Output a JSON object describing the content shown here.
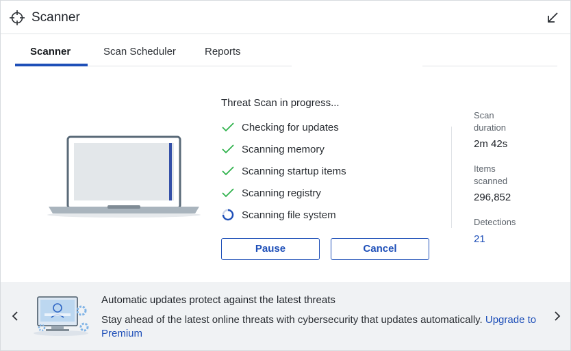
{
  "window": {
    "title": "Scanner",
    "title_icon": "crosshair-icon",
    "collapse_icon": "arrow-down-left-icon"
  },
  "tabs": [
    {
      "label": "Scanner",
      "active": true
    },
    {
      "label": "Scan Scheduler",
      "active": false
    },
    {
      "label": "Reports",
      "active": false
    }
  ],
  "scan": {
    "title": "Threat Scan in progress...",
    "steps": [
      {
        "label": "Checking for updates",
        "status": "done",
        "icon": "check-icon"
      },
      {
        "label": "Scanning memory",
        "status": "done",
        "icon": "check-icon"
      },
      {
        "label": "Scanning startup items",
        "status": "done",
        "icon": "check-icon"
      },
      {
        "label": "Scanning registry",
        "status": "done",
        "icon": "check-icon"
      },
      {
        "label": "Scanning file system",
        "status": "in-progress",
        "icon": "spinner-icon"
      }
    ],
    "pause_label": "Pause",
    "cancel_label": "Cancel"
  },
  "stats": {
    "duration_label": "Scan duration",
    "duration_value": "2m 42s",
    "items_label": "Items scanned",
    "items_value": "296,852",
    "detections_label": "Detections",
    "detections_value": "21"
  },
  "banner": {
    "title": "Automatic updates protect against the latest threats",
    "body": "Stay ahead of the latest online threats with cybersecurity that updates automatically.",
    "link": "Upgrade to Premium",
    "prev_icon": "chevron-left-icon",
    "next_icon": "chevron-right-icon",
    "illustration_icon": "monitor-update-icon"
  },
  "colors": {
    "accent": "#1e4fb8",
    "success": "#2fb24c",
    "banner_bg": "#f0f2f4"
  }
}
